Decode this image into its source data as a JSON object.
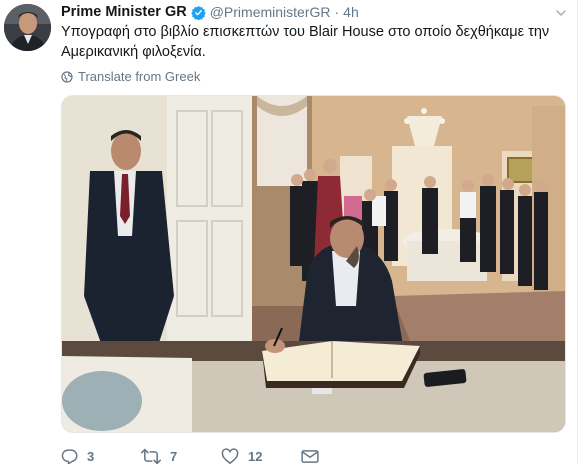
{
  "tweet": {
    "author_name": "Prime Minister GR",
    "verified": true,
    "handle": "@PrimeministerGR",
    "separator": "·",
    "time": "4h",
    "text": "Υπογραφή στο βιβλίο επισκεπτών του Blair House στο οποίο δεχθήκαμε την Αμερικανική φιλοξενία.",
    "translate_label": "Translate from Greek",
    "counts": {
      "replies": "3",
      "retweets": "7",
      "likes": "12"
    }
  },
  "colors": {
    "verified_blue": "#1da1f2",
    "secondary_text": "#657786"
  },
  "icons": {
    "reply": "reply-icon",
    "retweet": "retweet-icon",
    "like": "heart-icon",
    "dm": "envelope-icon",
    "verified": "verified-badge-icon",
    "translate": "globe-icon",
    "more": "chevron-down-icon"
  }
}
